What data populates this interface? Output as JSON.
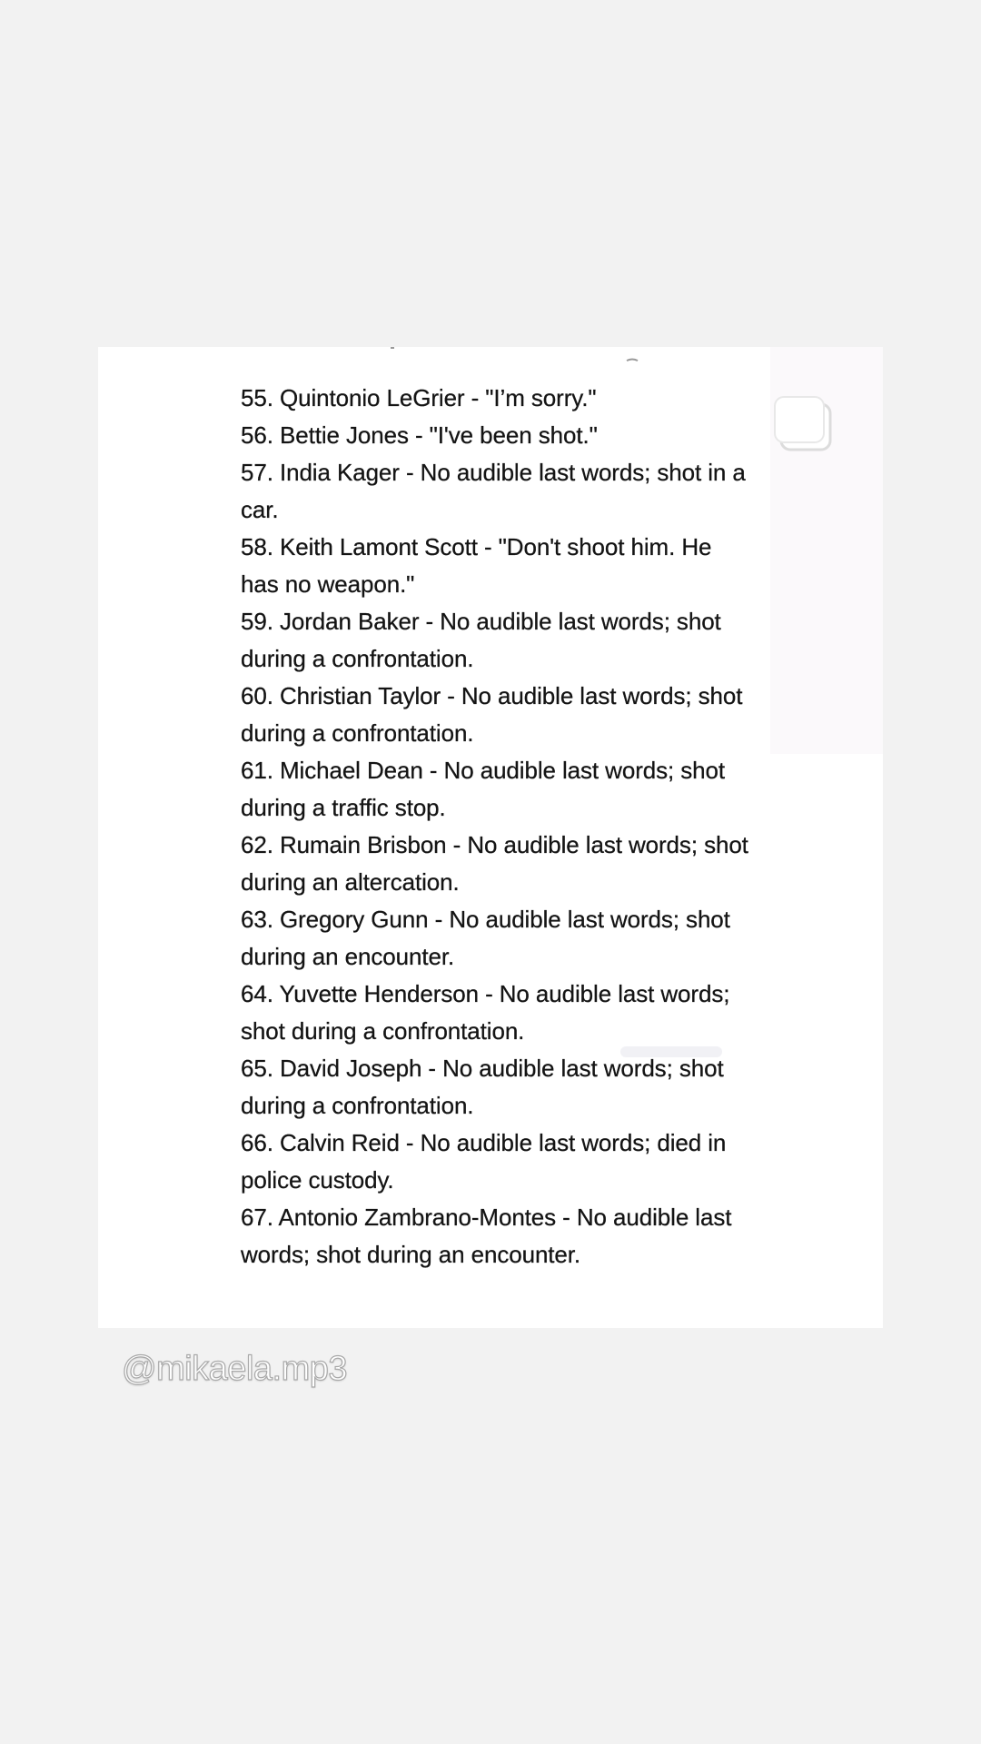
{
  "post": {
    "list_items": [
      "55. Quintonio LeGrier - \"I’m sorry.\"",
      "56. Bettie Jones - \"I've been shot.\"",
      "57. India Kager - No audible last words; shot in a car.",
      "58. Keith Lamont Scott - \"Don't shoot him. He has no weapon.\"",
      "59. Jordan Baker - No audible last words; shot during a confrontation.",
      "60. Christian Taylor - No audible last words; shot during a confrontation.",
      "61. Michael Dean - No audible last words; shot during a traffic stop.",
      "62. Rumain Brisbon - No audible last words; shot during an altercation.",
      "63. Gregory Gunn - No audible last words; shot during an encounter.",
      "64. Yuvette Henderson - No audible last words; shot during a confrontation.",
      "65. David Joseph - No audible last words; shot during a confrontation.",
      "66. Calvin Reid - No audible last words; died in police custody.",
      "67. Antonio Zambrano-Montes - No audible last words; shot during an encounter."
    ]
  },
  "overlay": {
    "username": "@mikaela.mp3",
    "icon": "multiple-photos-icon"
  },
  "colors": {
    "background": "#f2f2f2",
    "card": "#ffffff",
    "text": "#141414"
  }
}
